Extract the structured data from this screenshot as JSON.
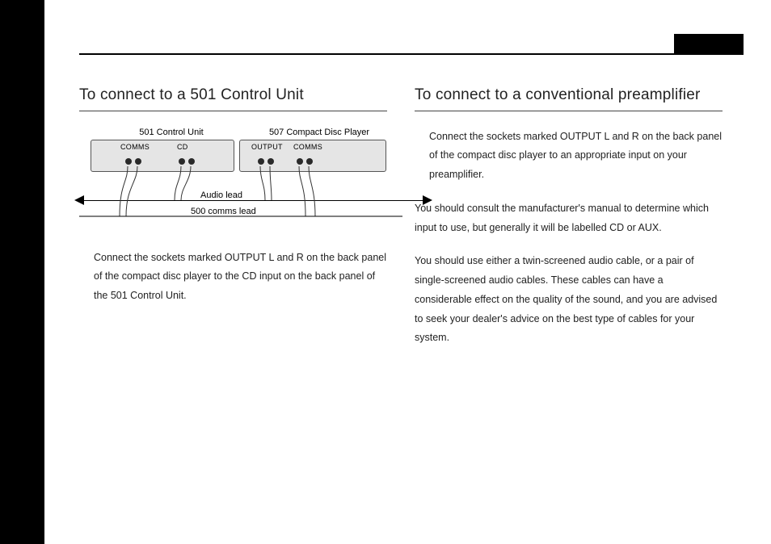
{
  "left_column": {
    "heading": "To connect to a 501 Control Unit",
    "diagram": {
      "device_left_label": "501 Control Unit",
      "device_right_label": "507 Compact Disc Player",
      "port_comms_left": "COMMS",
      "port_cd": "CD",
      "port_output": "OUTPUT",
      "port_comms_right": "COMMS",
      "audio_lead_label": "Audio lead",
      "comms_lead_label": "500 comms lead"
    },
    "paragraph1": "Connect the sockets marked OUTPUT L and R on the back panel of the compact disc player to the CD input on the back panel of the 501 Control Unit."
  },
  "right_column": {
    "heading": "To connect to a conventional preamplifier",
    "paragraph1": "Connect the sockets marked OUTPUT L and R on the back panel of the compact disc player to an appropriate input on your preamplifier.",
    "paragraph2": "You should consult the manufacturer's manual to determine which input to use, but generally it will be labelled CD or AUX.",
    "paragraph3": "You should use either a twin-screened audio cable, or a pair of single-screened audio cables. These cables can have a considerable effect on the quality of the sound, and you are advised to seek your dealer's advice on the best type of cables for your system."
  }
}
